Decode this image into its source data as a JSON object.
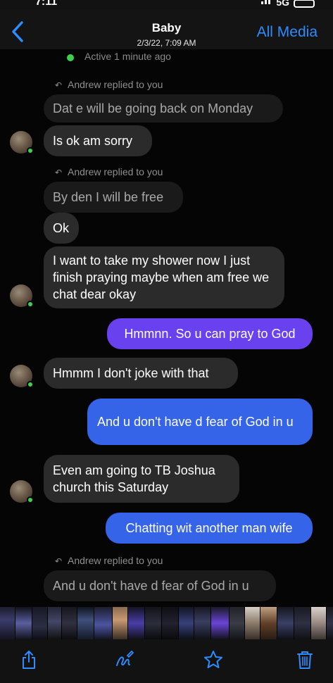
{
  "status": {
    "time": "7:11",
    "network": "5G"
  },
  "header": {
    "title": "Baby",
    "subtitle": "2/3/22, 7:09 AM",
    "all_media": "All Media",
    "accent": "#2d8cff"
  },
  "chat": {
    "active_status": "Active 1 minute ago",
    "reply_note": "Andrew replied to you",
    "messages": [
      {
        "kind": "quoted",
        "text": "Dat e will be going back on Monday"
      },
      {
        "kind": "incoming",
        "text": "Is ok am sorry"
      },
      {
        "kind": "quoted",
        "text": "By den I will be free"
      },
      {
        "kind": "incoming",
        "text": "Ok"
      },
      {
        "kind": "incoming",
        "text": "I want to take my shower now I just finish praying maybe when am free we chat dear okay"
      },
      {
        "kind": "outgoing",
        "text": "Hmmnn. So u can pray to God"
      },
      {
        "kind": "incoming",
        "text": "Hmmm I don't joke with that"
      },
      {
        "kind": "outgoing",
        "text": "And u don't have d fear of God in u"
      },
      {
        "kind": "incoming",
        "text": "Even am going to TB Joshua church this Saturday"
      },
      {
        "kind": "outgoing",
        "text": "Chatting wit another man wife"
      },
      {
        "kind": "quoted",
        "text": "And u don't have d fear of God in u"
      }
    ],
    "colors": {
      "incoming": "#2b2b2b",
      "outgoing_purple": "#6a41ee",
      "outgoing_blue": "#3664e8"
    }
  },
  "toolbar": {
    "icons": [
      "share-icon",
      "markup-icon",
      "favorite-star-icon",
      "trash-icon"
    ]
  }
}
